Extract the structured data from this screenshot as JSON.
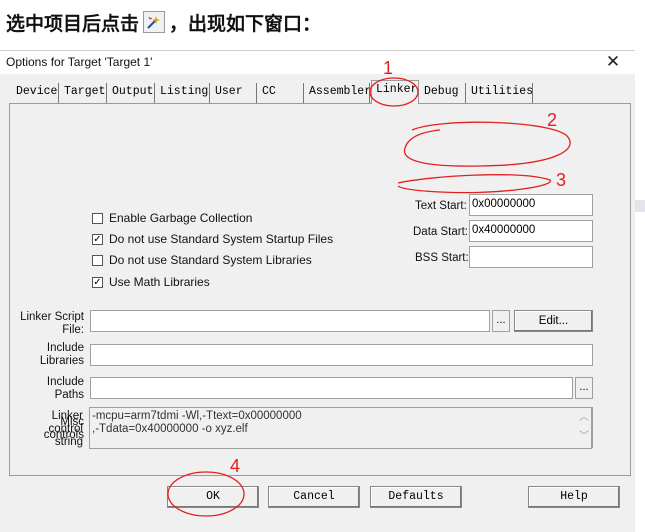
{
  "caption": {
    "before_icon": "选中项目后点击",
    "after_icon": "，出现如下窗口：",
    "icon": "options-wand-icon"
  },
  "dialog": {
    "title": "Options for Target 'Target 1'",
    "close_glyph": "✕",
    "tabs": [
      {
        "label": "Device"
      },
      {
        "label": "Target"
      },
      {
        "label": "Output"
      },
      {
        "label": "Listing"
      },
      {
        "label": "User"
      },
      {
        "label": "CC"
      },
      {
        "label": "Assembler"
      },
      {
        "label": "Linker"
      },
      {
        "label": "Debug"
      },
      {
        "label": "Utilities"
      }
    ],
    "active_tab": "Linker",
    "checkboxes": [
      {
        "label": "Enable Garbage Collection",
        "checked": false,
        "mark": ""
      },
      {
        "label": "Do not use Standard System Startup Files",
        "checked": true,
        "mark": "✓"
      },
      {
        "label": "Do not use Standard System Libraries",
        "checked": false,
        "mark": ""
      },
      {
        "label": "Use Math Libraries",
        "checked": true,
        "mark": "✓"
      }
    ],
    "text_start": {
      "label": "Text Start:",
      "value": "0x00000000"
    },
    "data_start": {
      "label": "Data Start:",
      "value": "0x40000000"
    },
    "bss_start": {
      "label": "BSS Start:",
      "value": ""
    },
    "linker_script": {
      "label_line1": "Linker Script",
      "label_line2": "File:",
      "value": "",
      "browse": "...",
      "edit": "Edit..."
    },
    "include_libraries": {
      "label_line1": "Include",
      "label_line2": "Libraries",
      "value": ""
    },
    "include_paths": {
      "label_line1": "Include",
      "label_line2": "Paths",
      "value": "",
      "browse": "..."
    },
    "misc_controls": {
      "label_line1": "Misc",
      "label_line2": "controls",
      "value": ""
    },
    "linker_control": {
      "label_line1": "Linker",
      "label_line2": "control",
      "label_line3": "string",
      "line1": "-mcpu=arm7tdmi -Wl,-Ttext=0x00000000",
      "line2": ",-Tdata=0x40000000 -o xyz.elf"
    },
    "buttons": {
      "ok": "OK",
      "cancel": "Cancel",
      "defaults": "Defaults",
      "help": "Help"
    }
  },
  "annotations": {
    "n1": "1",
    "n2": "2",
    "n3": "3",
    "n4": "4",
    "color": "#e32020"
  }
}
